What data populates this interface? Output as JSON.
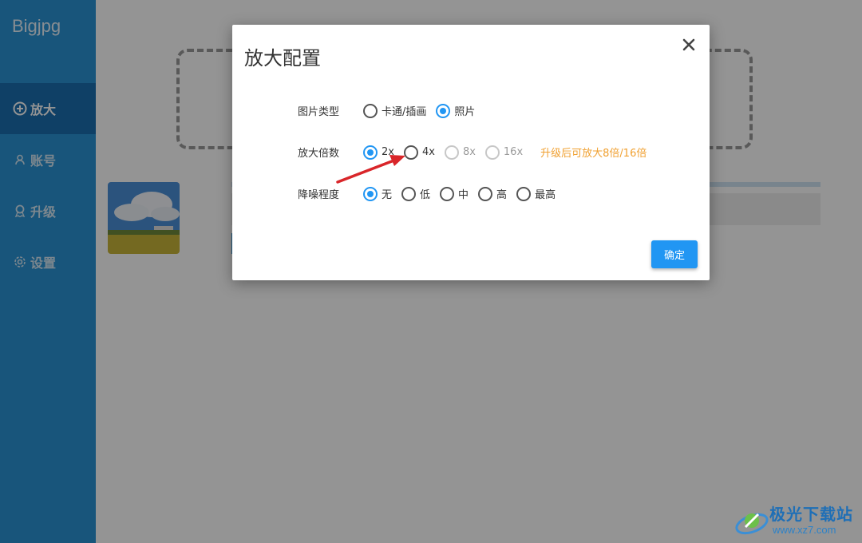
{
  "sidebar": {
    "brand": "Bigjpg",
    "items": [
      {
        "label": "放大",
        "icon": "plus-circle-icon",
        "active": true
      },
      {
        "label": "账号",
        "icon": "user-icon",
        "active": false
      },
      {
        "label": "升级",
        "icon": "award-icon",
        "active": false
      },
      {
        "label": "设置",
        "icon": "gear-icon",
        "active": false
      }
    ]
  },
  "modal": {
    "title": "放大配置",
    "close_icon": "close-icon",
    "image_type": {
      "label": "图片类型",
      "options": [
        {
          "label": "卡通/插画",
          "checked": false
        },
        {
          "label": "照片",
          "checked": true
        }
      ]
    },
    "scale": {
      "label": "放大倍数",
      "options": [
        {
          "label": "2x",
          "checked": true,
          "disabled": false
        },
        {
          "label": "4x",
          "checked": false,
          "disabled": false
        },
        {
          "label": "8x",
          "checked": false,
          "disabled": true
        },
        {
          "label": "16x",
          "checked": false,
          "disabled": true
        }
      ],
      "hint": "升级后可放大8倍/16倍"
    },
    "noise": {
      "label": "降噪程度",
      "options": [
        {
          "label": "无",
          "checked": true
        },
        {
          "label": "低",
          "checked": false
        },
        {
          "label": "中",
          "checked": false
        },
        {
          "label": "高",
          "checked": false
        },
        {
          "label": "最高",
          "checked": false
        }
      ]
    },
    "confirm_label": "确定"
  },
  "watermark": {
    "text": "极光下载站",
    "url": "www.xz7.com"
  },
  "colors": {
    "sidebar": "#2a93d4",
    "sidebar_active": "#1a6fb0",
    "accent": "#2196f3",
    "hint": "#f0a030",
    "arrow": "#d9262a"
  }
}
